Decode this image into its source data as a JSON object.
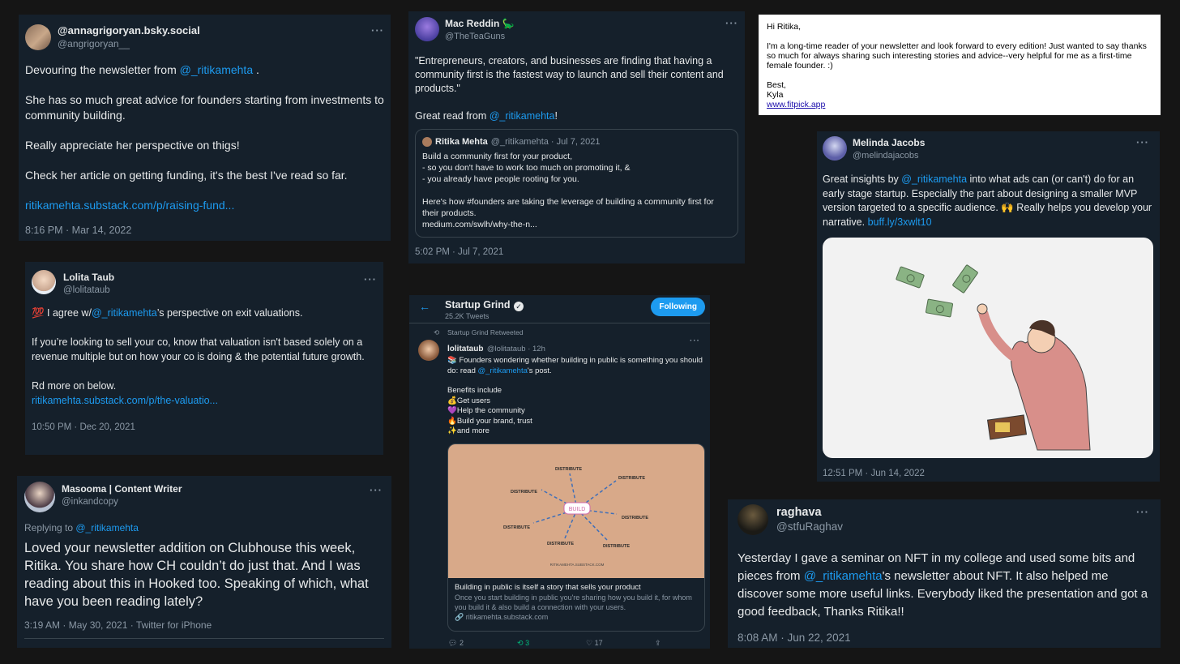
{
  "t1": {
    "name": "@annagrigoryan.bsky.social",
    "handle": "@angrigoryan__",
    "line1_pre": "Devouring the newsletter from ",
    "line1_link": "@_ritikamehta",
    "line1_post": " .",
    "p2": "She has so much great advice for founders starting from investments to community building.",
    "p3": "Really appreciate her perspective on thigs!",
    "p4": "Check her article on getting funding, it's the best I've read so far.",
    "url": "ritikamehta.substack.com/p/raising-fund...",
    "meta": "8:16 PM · Mar 14, 2022"
  },
  "t2": {
    "name": "Mac Reddin 🦕",
    "handle": "@TheTeaGuns",
    "quote_text": "\"Entrepreneurs, creators, and businesses are finding that having a community first is the fastest way to launch and sell their content and products.\"",
    "great_pre": "Great read from ",
    "great_link": "@_ritikamehta",
    "great_post": "!",
    "q_name": "Ritika Mehta",
    "q_handle": "@_ritikamehta · Jul 7, 2021",
    "q_text": "Build a community first for your product,\n- so you don't have to work too much on promoting it, &\n- you already have people rooting for you.\n\nHere's how #founders are taking the leverage of building a community first for their products.\nmedium.com/swlh/why-the-n...",
    "meta": "5:02 PM · Jul 7, 2021"
  },
  "email": {
    "greeting": "Hi Ritika,",
    "body": "I'm a long-time reader of your newsletter and look forward to every edition! Just wanted to say thanks so much for always sharing such interesting stories and advice--very helpful for me as a first-time female founder. :)",
    "signoff": "Best,",
    "signer": "Kyla",
    "link": "www.fitpick.app"
  },
  "t3": {
    "name": "Lolita Taub",
    "handle": "@lolitataub",
    "l1_pre": "💯 I agree w/",
    "l1_link": "@_ritikamehta",
    "l1_post": "’s perspective on exit valuations.",
    "p2": "If you’re looking to sell your co, know that valuation isn't based solely on a revenue multiple but on how your co is doing & the potential future growth.",
    "p3": "Rd more on below.",
    "url": "ritikamehta.substack.com/p/the-valuatio...",
    "meta": "10:50 PM · Dec 20, 2021"
  },
  "t4": {
    "name": "Startup Grind",
    "tweets": "25.2K Tweets",
    "follow": "Following",
    "retweeted": "Startup Grind Retweeted",
    "author": "lolitataub",
    "author_meta": "@lolitataub · 12h",
    "l1": "📚 Founders wondering whether building in public is something you should do: read ",
    "l1_link": "@_ritikamehta",
    "l1_post": "'s post.",
    "benefits": "Benefits include\n💰Get users\n💜Help the community\n🔥Build your brand, trust\n✨and more",
    "card_title": "Building in public is itself a story that sells your product",
    "card_desc": "Once you start building in public you're sharing how you build it, for whom you build it & also build a connection with your users.",
    "card_url": "🔗 ritikamehta.substack.com",
    "diagram_center": "BUILD",
    "diagram_word": "DISTRIBUTE",
    "diagram_footer": "RITIKAMEHTA.SUBSTACK.COM",
    "replies": "2",
    "retweets": "3",
    "likes": "17"
  },
  "t5": {
    "name": "Melinda Jacobs",
    "handle": "@melindajacobs",
    "pre": "Great insights by ",
    "link": "@_ritikamehta",
    "post": " into what ads can (or can't) do for an early stage startup. Especially the part about designing a smaller MVP version targeted to a specific audience. 🙌 Really helps you develop your narrative. ",
    "link2": "buff.ly/3xwlt10",
    "meta": "12:51 PM · Jun 14, 2022"
  },
  "t6": {
    "name": "Masooma | Content Writer",
    "handle": "@inkandcopy",
    "replying_pre": "Replying to ",
    "replying_link": "@_ritikamehta",
    "text": "Loved your newsletter addition on Clubhouse this week, Ritika. You share how CH couldn’t do just that. And I was reading about this in Hooked too. Speaking of which, what have you been reading lately?",
    "meta": "3:19 AM · May 30, 2021 · Twitter for iPhone"
  },
  "t7": {
    "name": "raghava",
    "handle": "@stfuRaghav",
    "pre": "Yesterday I gave a seminar on NFT in my college and used some bits and pieces from ",
    "link": "@_ritikamehta",
    "post": "'s newsletter about NFT. It also helped me discover some more useful links. Everybody liked the presentation and got a good feedback, Thanks Ritika!!",
    "meta": "8:08 AM · Jun 22, 2021"
  },
  "more": "···",
  "colors": {
    "bg": "#151515",
    "card": "#15202b",
    "accent": "#1d9bf0",
    "muted": "#8b98a5"
  }
}
